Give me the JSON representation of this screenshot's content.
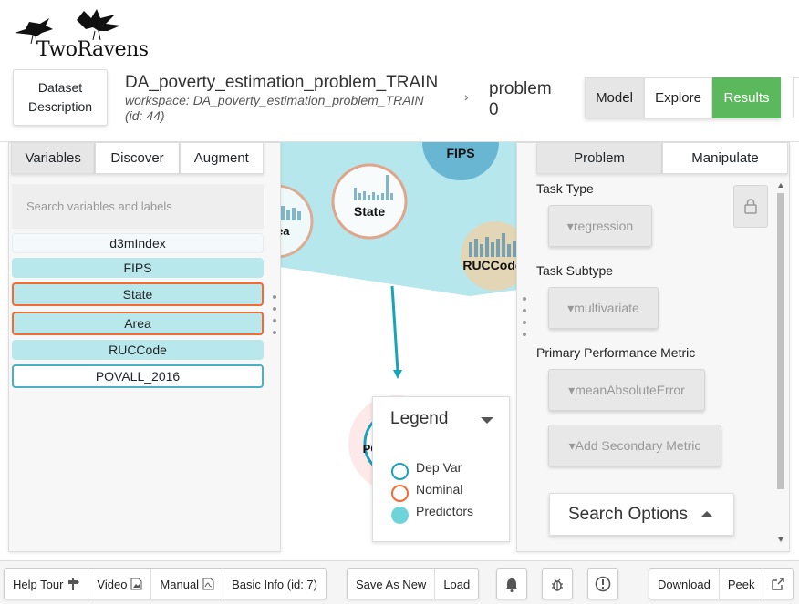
{
  "app": {
    "name": "TwoRavens"
  },
  "header": {
    "dataset_button": "Dataset Description",
    "problem_title": "DA_poverty_estimation_problem_TRAIN",
    "workspace": "workspace: DA_poverty_estimation_problem_TRAIN (id: 44)",
    "breadcrumb_separator": "›",
    "problem_name": "problem 0",
    "modes": [
      {
        "label": "Model",
        "active": true
      },
      {
        "label": "Explore",
        "active": false
      },
      {
        "label": "Results",
        "active": false
      }
    ]
  },
  "left_panel": {
    "tabs": [
      "Variables",
      "Discover",
      "Augment"
    ],
    "active_tab": "Variables",
    "search_placeholder": "Search variables and labels",
    "variables": [
      {
        "label": "d3mIndex",
        "role": "none"
      },
      {
        "label": "FIPS",
        "role": "predictor"
      },
      {
        "label": "State",
        "role": "nominal"
      },
      {
        "label": "Area",
        "role": "nominal"
      },
      {
        "label": "RUCCode",
        "role": "predictor"
      },
      {
        "label": "POVALL_2016",
        "role": "dep_var"
      }
    ]
  },
  "graph": {
    "nodes": [
      {
        "label": "FIPS"
      },
      {
        "label": "State"
      },
      {
        "label": "Area"
      },
      {
        "label": "RUCCode"
      },
      {
        "label": "PO"
      }
    ]
  },
  "legend": {
    "title": "Legend",
    "items": [
      {
        "label": "Dep Var",
        "color": "#1aa0b8"
      },
      {
        "label": "Nominal",
        "color": "#f46a30"
      },
      {
        "label": "Predictors",
        "color": "#6fd4da"
      }
    ]
  },
  "right_panel": {
    "tabs": [
      "Problem",
      "Manipulate"
    ],
    "active_tab": "Problem",
    "task_type_label": "Task Type",
    "task_type_value": "▾regression",
    "task_subtype_label": "Task Subtype",
    "task_subtype_value": "▾multivariate",
    "metric_label": "Primary Performance Metric",
    "metric_value": "▾meanAbsoluteError",
    "secondary_metric": "▾Add Secondary Metric",
    "search_options": "Search Options"
  },
  "footer": {
    "left_group": [
      "Help Tour",
      "Video",
      "Manual",
      "Basic Info (id: 7)"
    ],
    "save_group": [
      "Save As New",
      "Load"
    ],
    "icons": [
      "bell-icon",
      "bug-icon",
      "alert-icon"
    ],
    "right_group": [
      "Download",
      "Peek"
    ]
  },
  "colors": {
    "results_green": "#5cb85c",
    "predictor_fill": "#b8e8ec",
    "nominal_border": "#f46a30",
    "dep_border": "#4bb0c6",
    "hull": "#aee4ea"
  }
}
